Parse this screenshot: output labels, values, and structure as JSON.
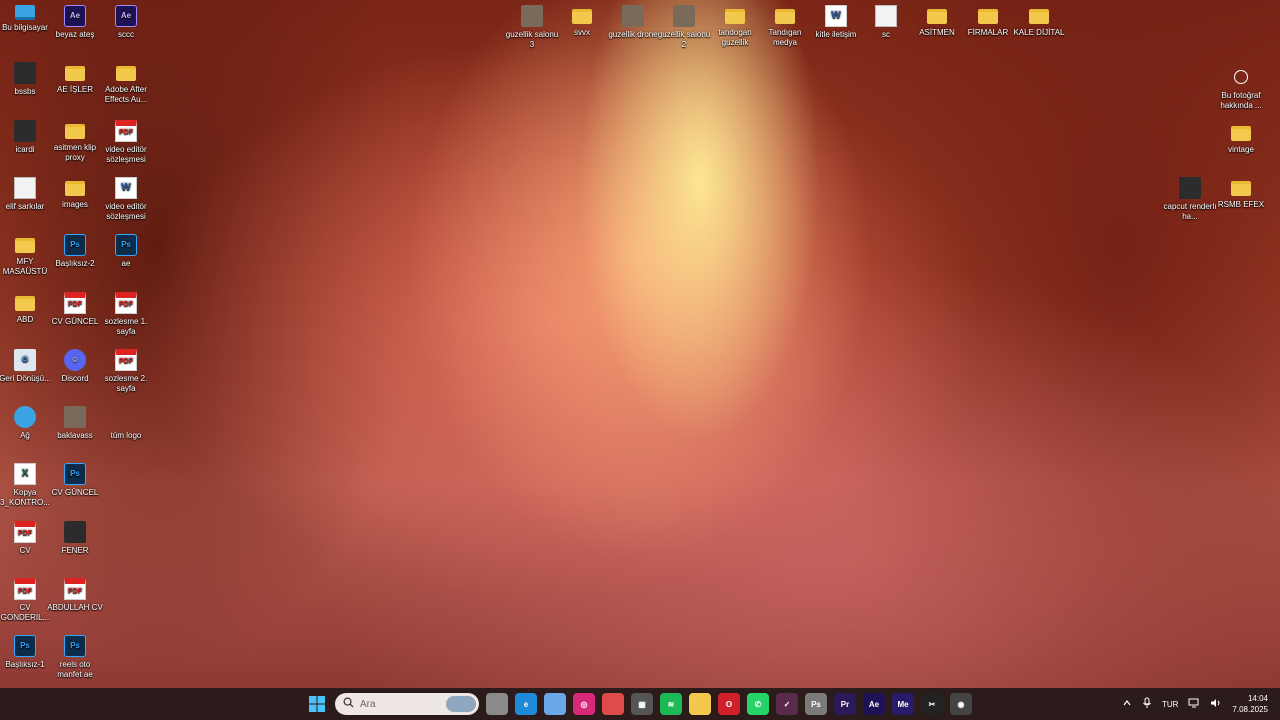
{
  "desktop": {
    "left_icons": [
      {
        "label": "Bu bilgisayar",
        "type": "pc"
      },
      {
        "label": "beyaz ateş",
        "type": "ae"
      },
      {
        "label": "sccc",
        "type": "ae"
      },
      {
        "label": "bssbs",
        "type": "dark"
      },
      {
        "label": "AE İŞLER",
        "type": "folder"
      },
      {
        "label": "Adobe After Effects Au...",
        "type": "folder"
      },
      {
        "label": "icardi",
        "type": "dark"
      },
      {
        "label": "asitmen klip proxy",
        "type": "folder"
      },
      {
        "label": "video editör sözleşmesi",
        "type": "pdf"
      },
      {
        "label": "elif sarkılar",
        "type": "file"
      },
      {
        "label": "images",
        "type": "folder"
      },
      {
        "label": "video editör sözleşmesi",
        "type": "word"
      },
      {
        "label": "MFY MASAÜSTÜ",
        "type": "folder"
      },
      {
        "label": "Başlıksız-2",
        "type": "ps"
      },
      {
        "label": "ae",
        "type": "ps"
      },
      {
        "label": "ABD",
        "type": "folder"
      },
      {
        "label": "CV GÜNCEL",
        "type": "pdf"
      },
      {
        "label": "sozlesme 1. sayfa",
        "type": "pdf"
      },
      {
        "label": "Geri Dönüşü...",
        "type": "recycle"
      },
      {
        "label": "Discord",
        "type": "discord"
      },
      {
        "label": "sozlesme 2. sayfa",
        "type": "pdf"
      },
      {
        "label": "Ağ",
        "type": "net"
      },
      {
        "label": "baklavass",
        "type": "img"
      },
      {
        "label": "tüm logo",
        "type": "none"
      },
      {
        "label": "Kopya 3_KONTRO...",
        "type": "xls"
      },
      {
        "label": "CV GÜNCEL",
        "type": "ps"
      },
      {
        "label": "CV",
        "type": "pdf"
      },
      {
        "label": "FENER",
        "type": "dark"
      },
      {
        "label": "CV GONDERIL...",
        "type": "pdf"
      },
      {
        "label": "ABDULLAH CV",
        "type": "pdf"
      },
      {
        "label": "Başlıksız-1",
        "type": "ps"
      },
      {
        "label": "reels oto manfet ae",
        "type": "ps"
      }
    ],
    "top_icons": [
      {
        "label": "guzellik salonu 3",
        "type": "img"
      },
      {
        "label": "svvx",
        "type": "folder"
      },
      {
        "label": "guzellik drone",
        "type": "img"
      },
      {
        "label": "guzellik salonu 2",
        "type": "img"
      },
      {
        "label": "tandogan guzellik",
        "type": "folder"
      },
      {
        "label": "Tandıgan medya",
        "type": "folder"
      },
      {
        "label": "kitle iletişim",
        "type": "word"
      },
      {
        "label": "sc",
        "type": "file"
      },
      {
        "label": "ASİTMEN",
        "type": "folder"
      },
      {
        "label": "FİRMALAR",
        "type": "folder"
      },
      {
        "label": "KALE DİJİTAL",
        "type": "folder"
      }
    ],
    "right_icons": [
      {
        "label": "Bu fotoğraf hakkında ...",
        "type": "circle"
      },
      {
        "label": "vintage",
        "type": "folder"
      },
      {
        "label": "capcut renderlı ha...",
        "type": "dark"
      },
      {
        "label": "RSMB EFEX",
        "type": "folder"
      }
    ]
  },
  "taskbar": {
    "search_placeholder": "Ara",
    "apps": [
      {
        "name": "task-view",
        "text": "",
        "color": "#8a8a8a"
      },
      {
        "name": "edge",
        "text": "e",
        "color": "#1f8ad8"
      },
      {
        "name": "copilot",
        "text": "",
        "color": "#6aa7e8"
      },
      {
        "name": "instagram",
        "text": "◎",
        "color": "#d6297a"
      },
      {
        "name": "snipping",
        "text": "",
        "color": "#e04a4a"
      },
      {
        "name": "store",
        "text": "▦",
        "color": "#555555"
      },
      {
        "name": "spotify",
        "text": "≋",
        "color": "#1db954"
      },
      {
        "name": "file-explorer",
        "text": "",
        "color": "#f2c94c"
      },
      {
        "name": "opera",
        "text": "O",
        "color": "#d0202c"
      },
      {
        "name": "whatsapp",
        "text": "✆",
        "color": "#25d366"
      },
      {
        "name": "davinci",
        "text": "✓",
        "color": "#5a2a4a"
      },
      {
        "name": "photoshop",
        "text": "Ps",
        "color": "#7a7a7a"
      },
      {
        "name": "premiere",
        "text": "Pr",
        "color": "#2a1a5a"
      },
      {
        "name": "after-effects",
        "text": "Ae",
        "color": "#1f1254"
      },
      {
        "name": "media-encoder",
        "text": "Me",
        "color": "#2a1a6a"
      },
      {
        "name": "capcut",
        "text": "✂",
        "color": "#222222"
      },
      {
        "name": "chrome-alt",
        "text": "◉",
        "color": "#444444"
      }
    ],
    "tray": {
      "language": "TUR",
      "time": "14:04",
      "date": "7.08.2025"
    }
  }
}
